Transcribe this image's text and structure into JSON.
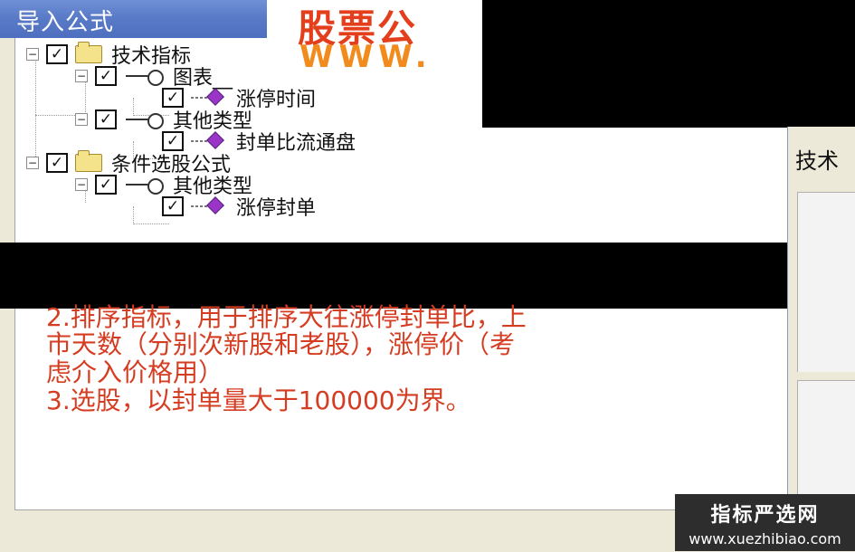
{
  "window": {
    "title": "导入公式"
  },
  "tree": {
    "items": [
      {
        "type": "folder",
        "label": "技术指标",
        "checked": true,
        "expanded": true
      },
      {
        "type": "category",
        "label": "图表__",
        "checked": true,
        "expanded": true
      },
      {
        "type": "formula",
        "label": "涨停时间",
        "checked": true
      },
      {
        "type": "category",
        "label": "其他类型",
        "checked": true,
        "expanded": true
      },
      {
        "type": "formula",
        "label": "封单比流通盘",
        "checked": true
      },
      {
        "type": "folder",
        "label": "条件选股公式",
        "checked": true,
        "expanded": true
      },
      {
        "type": "category",
        "label": "其他类型",
        "checked": true,
        "expanded": true
      },
      {
        "type": "formula",
        "label": "涨停封单",
        "checked": true
      }
    ]
  },
  "banner": {
    "main_text": "股票公",
    "url_text": "WWW."
  },
  "description": {
    "lines": [
      "2.排序指标，用于排序大往涨停封单比，上",
      "市天数（分别次新股和老股），涨停价（考",
      "虑介入价格用）",
      "3.选股，以封单量大于100000为界。"
    ]
  },
  "right_panel": {
    "tab_label": "技术"
  },
  "watermark": {
    "title": "指标严选网",
    "url": "www.xuezhibiao.com"
  },
  "colors": {
    "title_bar": "#5a7bc7",
    "description_text": "#d53d22",
    "logo_red": "#e33f1d",
    "logo_orange": "#f28b1d"
  },
  "icons": {
    "checkbox": "checkbox-checked",
    "folder": "folder-icon",
    "category": "key-icon",
    "formula": "formula-icon"
  }
}
